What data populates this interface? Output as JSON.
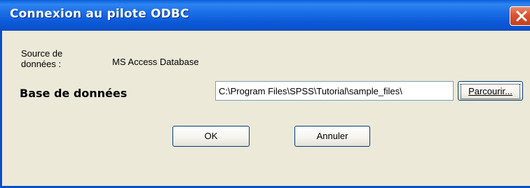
{
  "window": {
    "title": "Connexion au pilote ODBC"
  },
  "form": {
    "source_label": "Source de\ndonnées :",
    "source_value": "MS Access Database",
    "database_label": "Base de données",
    "database_value": "C:\\Program Files\\SPSS\\Tutorial\\sample_files\\",
    "browse_label": "Parcourir..."
  },
  "buttons": {
    "ok_label": "OK",
    "cancel_label": "Annuler"
  },
  "colors": {
    "titlebar": "#0a5fd8",
    "dialog_bg": "#ece9d8",
    "close_button": "#d8532f"
  },
  "icons": {
    "close": "close-icon"
  }
}
